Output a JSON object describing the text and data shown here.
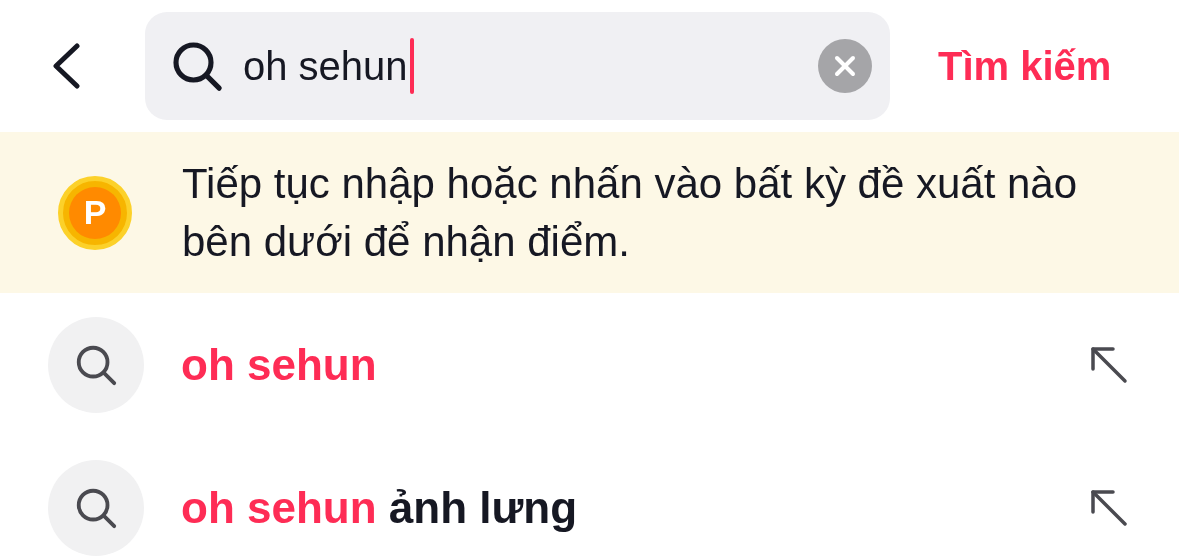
{
  "search": {
    "value": "oh sehun",
    "submit_label": "Tìm kiếm"
  },
  "banner": {
    "text": "Tiếp tục nhập hoặc nhấn vào bất kỳ đề xuất nào bên dưới để nhận điểm.",
    "coin_letter": "P"
  },
  "suggestions": [
    {
      "match": "oh sehun"
    },
    {
      "match": "oh sehun",
      "rest": "ảnh lưng"
    }
  ]
}
